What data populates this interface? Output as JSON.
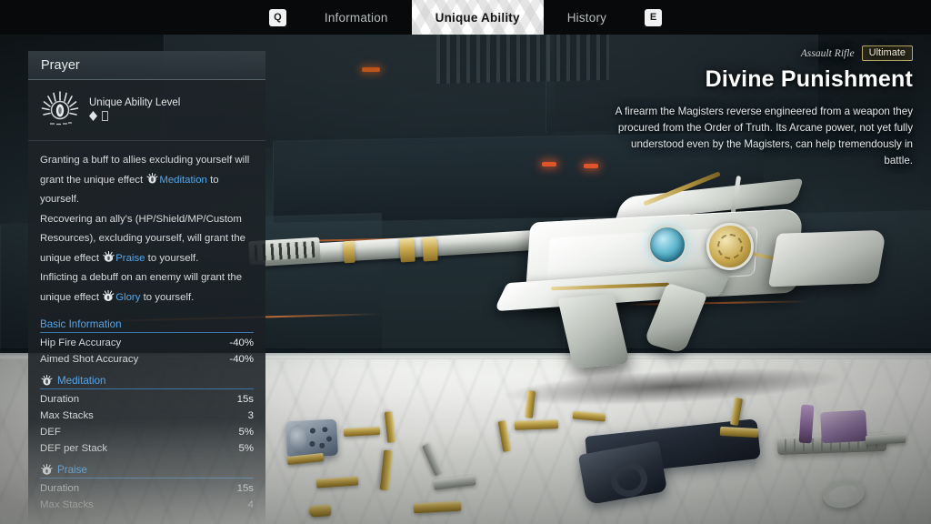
{
  "tabbar": {
    "left_key": "Q",
    "right_key": "E",
    "tabs": [
      {
        "label": "Information",
        "active": false
      },
      {
        "label": "Unique Ability",
        "active": true
      },
      {
        "label": "History",
        "active": false
      }
    ]
  },
  "panel": {
    "title": "Prayer",
    "ability": {
      "icon": "radiant-prayer-icon",
      "level_label": "Unique Ability Level",
      "level_value": "◇ ⎕"
    },
    "description": {
      "line1_a": "Granting a buff to allies excluding yourself will grant the unique effect",
      "line1_effect": "Meditation",
      "line1_b": "to yourself.",
      "line2_a": "Recovering an ally's (HP/Shield/MP/Custom Resources), excluding yourself, will grant the unique effect",
      "line2_effect": "Praise",
      "line2_b": "to yourself.",
      "line3_a": "Inflicting a debuff on an enemy will grant the unique effect",
      "line3_effect": "Glory",
      "line3_b": "to yourself."
    },
    "sections": [
      {
        "title": "Basic Information",
        "has_icon": false,
        "rows": [
          {
            "label": "Hip Fire Accuracy",
            "value": "-40%"
          },
          {
            "label": "Aimed Shot Accuracy",
            "value": "-40%"
          }
        ]
      },
      {
        "title": "Meditation",
        "has_icon": true,
        "icon": "meditation-icon",
        "rows": [
          {
            "label": "Duration",
            "value": "15s"
          },
          {
            "label": "Max Stacks",
            "value": "3"
          },
          {
            "label": "DEF",
            "value": "5%"
          },
          {
            "label": "DEF per Stack",
            "value": "5%"
          }
        ]
      },
      {
        "title": "Praise",
        "has_icon": true,
        "icon": "praise-icon",
        "rows": [
          {
            "label": "Duration",
            "value": "15s"
          },
          {
            "label": "Max Stacks",
            "value": "4"
          }
        ]
      }
    ]
  },
  "weapon": {
    "type": "Assault Rifle",
    "rarity_badge": "Ultimate",
    "name": "Divine Punishment",
    "description": "A firearm the Magisters reverse engineered from a weapon they procured from the Order of Truth. Its Arcane power, not yet fully understood even by the Magisters, can help tremendously in battle."
  },
  "colors": {
    "accent_blue": "#55a6e8",
    "badge_gold": "#b9a96a",
    "panel_bg": "#1e2428",
    "text_primary": "#e3e7e7"
  }
}
